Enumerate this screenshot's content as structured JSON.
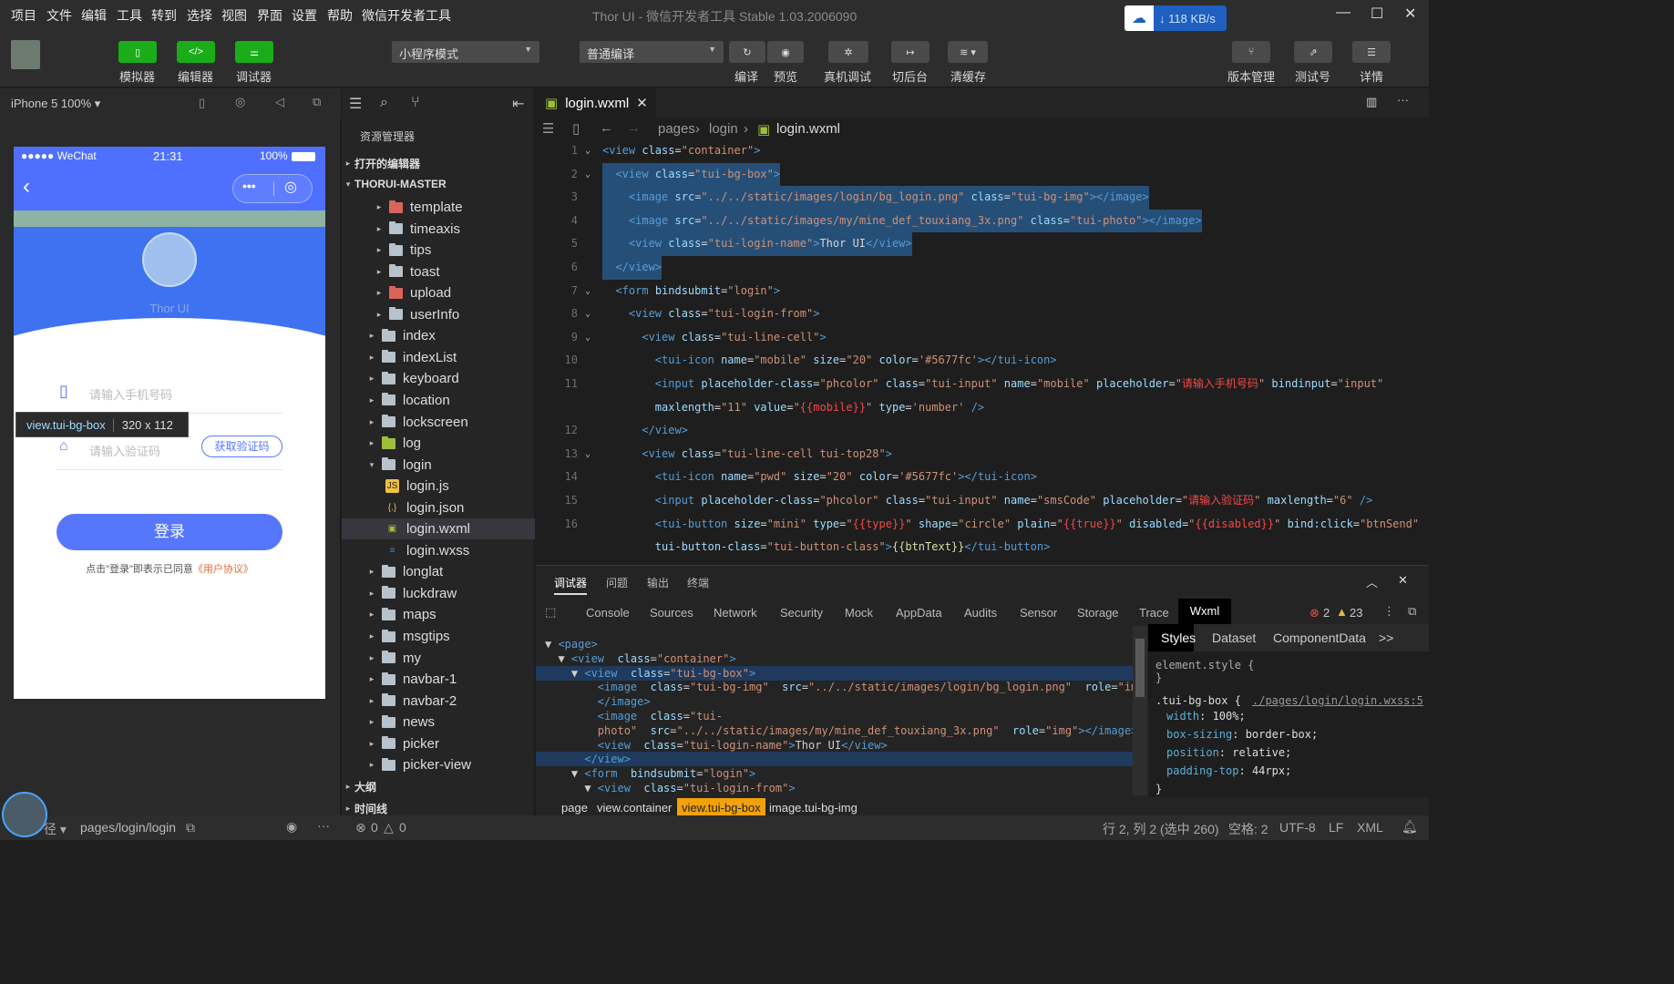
{
  "menu": [
    "项目",
    "文件",
    "编辑",
    "工具",
    "转到",
    "选择",
    "视图",
    "界面",
    "设置",
    "帮助",
    "微信开发者工具"
  ],
  "window_title": "Thor UI - 微信开发者工具 Stable 1.03.2006090",
  "network_speed": "↓ 118 KB/s",
  "toolbar": {
    "simulator": "模拟器",
    "editor": "编辑器",
    "debugger": "调试器",
    "mode_select": "小程序模式",
    "compile_select": "普通编译",
    "compile": "编译",
    "preview": "预览",
    "real_debug": "真机调试",
    "background": "切后台",
    "clear_cache": "清缓存",
    "version": "版本管理",
    "test_account": "测试号",
    "details": "详情"
  },
  "simulator": {
    "device": "iPhone 5 100%",
    "status_left": "●●●●● WeChat",
    "time": "21:31",
    "battery": "100%",
    "hero_name": "Thor UI",
    "inspect_tag": "view.tui-bg-box",
    "inspect_size": "320 x 112",
    "phone_placeholder": "请输入手机号码",
    "code_placeholder": "请输入验证码",
    "code_button": "获取验证码",
    "login_button": "登录",
    "agreement": "点击\"登录\"即表示已同意",
    "agreement_link": "《用户协议》"
  },
  "explorer": {
    "title": "资源管理器",
    "open_editors": "打开的编辑器",
    "project": "THORUI-MASTER",
    "outline": "大纲",
    "timeline": "时间线",
    "items": [
      {
        "label": "template",
        "indent": 2,
        "kind": "folder-red",
        "open": false
      },
      {
        "label": "timeaxis",
        "indent": 2,
        "kind": "folder",
        "open": false
      },
      {
        "label": "tips",
        "indent": 2,
        "kind": "folder",
        "open": false
      },
      {
        "label": "toast",
        "indent": 2,
        "kind": "folder",
        "open": false
      },
      {
        "label": "upload",
        "indent": 2,
        "kind": "folder-red",
        "open": false
      },
      {
        "label": "userInfo",
        "indent": 2,
        "kind": "folder",
        "open": false
      },
      {
        "label": "index",
        "indent": 1,
        "kind": "folder",
        "open": false
      },
      {
        "label": "indexList",
        "indent": 1,
        "kind": "folder",
        "open": false
      },
      {
        "label": "keyboard",
        "indent": 1,
        "kind": "folder",
        "open": false
      },
      {
        "label": "location",
        "indent": 1,
        "kind": "folder",
        "open": false
      },
      {
        "label": "lockscreen",
        "indent": 1,
        "kind": "folder",
        "open": false
      },
      {
        "label": "log",
        "indent": 1,
        "kind": "folder-green",
        "open": false
      },
      {
        "label": "login",
        "indent": 1,
        "kind": "folder",
        "open": true
      },
      {
        "label": "login.js",
        "indent": 2,
        "kind": "js",
        "leaf": true
      },
      {
        "label": "login.json",
        "indent": 2,
        "kind": "json",
        "leaf": true
      },
      {
        "label": "login.wxml",
        "indent": 2,
        "kind": "wxml",
        "leaf": true,
        "selected": true
      },
      {
        "label": "login.wxss",
        "indent": 2,
        "kind": "wxss",
        "leaf": true
      },
      {
        "label": "longlat",
        "indent": 1,
        "kind": "folder",
        "open": false
      },
      {
        "label": "luckdraw",
        "indent": 1,
        "kind": "folder",
        "open": false
      },
      {
        "label": "maps",
        "indent": 1,
        "kind": "folder",
        "open": false
      },
      {
        "label": "msgtips",
        "indent": 1,
        "kind": "folder",
        "open": false
      },
      {
        "label": "my",
        "indent": 1,
        "kind": "folder",
        "open": false
      },
      {
        "label": "navbar-1",
        "indent": 1,
        "kind": "folder",
        "open": false
      },
      {
        "label": "navbar-2",
        "indent": 1,
        "kind": "folder",
        "open": false
      },
      {
        "label": "news",
        "indent": 1,
        "kind": "folder",
        "open": false
      },
      {
        "label": "picker",
        "indent": 1,
        "kind": "folder",
        "open": false
      },
      {
        "label": "picker-view",
        "indent": 1,
        "kind": "folder",
        "open": false
      }
    ]
  },
  "editor": {
    "tab": "login.wxml",
    "breadcrumb": [
      "pages",
      "login",
      "login.wxml"
    ],
    "lines": [
      {
        "n": "1",
        "fold": true,
        "hl": false,
        "html": "<span class=\"t\">&lt;view</span> <span class=\"a\">class</span>=<span class=\"v\">\"container\"</span><span class=\"t\">&gt;</span>"
      },
      {
        "n": "2",
        "fold": true,
        "hl": true,
        "html": "  <span class=\"t\">&lt;view</span> <span class=\"a\">class</span>=<span class=\"v\">\"tui-bg-box\"</span><span class=\"t\">&gt;</span>"
      },
      {
        "n": "3",
        "fold": false,
        "hl": true,
        "html": "    <span class=\"t\">&lt;image</span> <span class=\"a\">src</span>=<span class=\"v\">\"../../static/images/login/bg_login.png\"</span> <span class=\"a\">class</span>=<span class=\"v\">\"tui-bg-img\"</span><span class=\"t\">&gt;&lt;/image&gt;</span>"
      },
      {
        "n": "4",
        "fold": false,
        "hl": true,
        "html": "    <span class=\"t\">&lt;image</span> <span class=\"a\">src</span>=<span class=\"v\">\"../../static/images/my/mine_def_touxiang_3x.png\"</span> <span class=\"a\">class</span>=<span class=\"v\">\"tui-photo\"</span><span class=\"t\">&gt;&lt;/image&gt;</span>"
      },
      {
        "n": "5",
        "fold": false,
        "hl": true,
        "html": "    <span class=\"t\">&lt;view</span> <span class=\"a\">class</span>=<span class=\"v\">\"tui-login-name\"</span><span class=\"t\">&gt;</span>Thor UI<span class=\"t\">&lt;/view&gt;</span>"
      },
      {
        "n": "6",
        "fold": false,
        "hl": true,
        "html": "  <span class=\"t\">&lt;/view&gt;</span>"
      },
      {
        "n": "7",
        "fold": true,
        "hl": false,
        "html": "  <span class=\"t\">&lt;form</span> <span class=\"a\">bindsubmit</span>=<span class=\"v\">\"login\"</span><span class=\"t\">&gt;</span>"
      },
      {
        "n": "8",
        "fold": true,
        "hl": false,
        "html": "    <span class=\"t\">&lt;view</span> <span class=\"a\">class</span>=<span class=\"v\">\"tui-login-from\"</span><span class=\"t\">&gt;</span>"
      },
      {
        "n": "9",
        "fold": true,
        "hl": false,
        "html": "      <span class=\"t\">&lt;view</span> <span class=\"a\">class</span>=<span class=\"v\">\"tui-line-cell\"</span><span class=\"t\">&gt;</span>"
      },
      {
        "n": "10",
        "fold": false,
        "hl": false,
        "html": "        <span class=\"t\">&lt;tui-icon</span> <span class=\"a\">name</span>=<span class=\"v\">\"mobile\"</span> <span class=\"a\">size</span>=<span class=\"v\">\"20\"</span> <span class=\"a\">color</span>=<span class=\"v\">'#5677fc'</span><span class=\"t\">&gt;&lt;/tui-icon&gt;</span>"
      },
      {
        "n": "11",
        "fold": false,
        "hl": false,
        "html": "        <span class=\"t\">&lt;input</span> <span class=\"a\">placeholder-class</span>=<span class=\"v\">\"phcolor\"</span> <span class=\"a\">class</span>=<span class=\"v\">\"tui-input\"</span> <span class=\"a\">name</span>=<span class=\"v\">\"mobile\"</span> <span class=\"a\">placeholder</span>=<span class=\"v\">\"</span><span class=\"r\">请输入手机号码</span><span class=\"v\">\"</span> <span class=\"a\">bindinput</span>=<span class=\"v\">\"input\"</span>"
      },
      {
        "n": "",
        "fold": false,
        "hl": false,
        "html": "        <span class=\"a\">maxlength</span>=<span class=\"v\">\"11\"</span> <span class=\"a\">value</span>=<span class=\"v\">\"</span><span class=\"r\">{{mobile}}</span><span class=\"v\">\"</span> <span class=\"a\">type</span>=<span class=\"v\">'number'</span> <span class=\"t\">/&gt;</span>"
      },
      {
        "n": "12",
        "fold": false,
        "hl": false,
        "html": "      <span class=\"t\">&lt;/view&gt;</span>"
      },
      {
        "n": "13",
        "fold": true,
        "hl": false,
        "html": "      <span class=\"t\">&lt;view</span> <span class=\"a\">class</span>=<span class=\"v\">\"tui-line-cell tui-top28\"</span><span class=\"t\">&gt;</span>"
      },
      {
        "n": "14",
        "fold": false,
        "hl": false,
        "html": "        <span class=\"t\">&lt;tui-icon</span> <span class=\"a\">name</span>=<span class=\"v\">\"pwd\"</span> <span class=\"a\">size</span>=<span class=\"v\">\"20\"</span> <span class=\"a\">color</span>=<span class=\"v\">'#5677fc'</span><span class=\"t\">&gt;&lt;/tui-icon&gt;</span>"
      },
      {
        "n": "15",
        "fold": false,
        "hl": false,
        "html": "        <span class=\"t\">&lt;input</span> <span class=\"a\">placeholder-class</span>=<span class=\"v\">\"phcolor\"</span> <span class=\"a\">class</span>=<span class=\"v\">\"tui-input\"</span> <span class=\"a\">name</span>=<span class=\"v\">\"smsCode\"</span> <span class=\"a\">placeholder</span>=<span class=\"v\">\"</span><span class=\"r\">请输入验证码</span><span class=\"v\">\"</span> <span class=\"a\">maxlength</span>=<span class=\"v\">\"6\"</span> <span class=\"t\">/&gt;</span>"
      },
      {
        "n": "16",
        "fold": false,
        "hl": false,
        "html": "        <span class=\"t\">&lt;tui-button</span> <span class=\"a\">size</span>=<span class=\"v\">\"mini\"</span> <span class=\"a\">type</span>=<span class=\"v\">\"</span><span class=\"r\">{{type}}</span><span class=\"v\">\"</span> <span class=\"a\">shape</span>=<span class=\"v\">\"circle\"</span> <span class=\"a\">plain</span>=<span class=\"v\">\"</span><span class=\"r\">{{true}}</span><span class=\"v\">\"</span> <span class=\"a\">disabled</span>=<span class=\"v\">\"</span><span class=\"r\">{{disabled}}</span><span class=\"v\">\"</span> <span class=\"a\">bind:click</span>=<span class=\"v\">\"btnSend\"</span>"
      },
      {
        "n": "",
        "fold": false,
        "hl": false,
        "html": "        <span class=\"a\">tui-button-class</span>=<span class=\"v\">\"tui-button-class\"</span><span class=\"t\">&gt;</span><span class=\"y\">{{btnText}}</span><span class=\"t\">&lt;/tui-button&gt;</span>"
      }
    ]
  },
  "devtools": {
    "top_tabs": [
      "调试器",
      "问题",
      "输出",
      "终端"
    ],
    "panel_tabs": [
      "Console",
      "Sources",
      "Network",
      "Security",
      "Mock",
      "AppData",
      "Audits",
      "Sensor",
      "Storage",
      "Trace",
      "Wxml"
    ],
    "errors": "2",
    "warnings": "23",
    "dom_lines": [
      {
        "html": "▼ <span class=\"t\">&lt;page&gt;</span>",
        "sel": false
      },
      {
        "html": "  ▼ <span class=\"t\">&lt;view</span>  <span class=\"a\">class</span>=<span class=\"v\">\"container\"</span><span class=\"t\">&gt;</span>",
        "sel": false
      },
      {
        "html": "    ▼ <span class=\"t\">&lt;view</span>  <span class=\"a\">class</span>=<span class=\"v\">\"tui-bg-box\"</span><span class=\"t\">&gt;</span>",
        "sel": true
      },
      {
        "html": "        <span class=\"t\">&lt;image</span>  <span class=\"a\">class</span>=<span class=\"v\">\"tui-bg-img\"</span>  <span class=\"a\">src</span>=<span class=\"v\">\"../../static/images/login/bg_login.png\"</span>  <span class=\"a\">role</span>=<span class=\"v\">\"img\"</span><span class=\"t\">&gt;</span>",
        "sel": false
      },
      {
        "html": "        <span class=\"t\">&lt;/image&gt;</span>",
        "sel": false
      },
      {
        "html": "        <span class=\"t\">&lt;image</span>  <span class=\"a\">class</span>=<span class=\"v\">\"tui-</span>",
        "sel": false
      },
      {
        "html": "        <span class=\"v\">photo\"</span>  <span class=\"a\">src</span>=<span class=\"v\">\"../../static/images/my/mine_def_touxiang_3x.png\"</span>  <span class=\"a\">role</span>=<span class=\"v\">\"img\"</span><span class=\"t\">&gt;&lt;/image&gt;</span>",
        "sel": false
      },
      {
        "html": "        <span class=\"t\">&lt;view</span>  <span class=\"a\">class</span>=<span class=\"v\">\"tui-login-name\"</span><span class=\"t\">&gt;</span>Thor UI<span class=\"t\">&lt;/view&gt;</span>",
        "sel": false
      },
      {
        "html": "      <span class=\"t\">&lt;/view&gt;</span>",
        "sel": true
      },
      {
        "html": "    ▼ <span class=\"t\">&lt;form</span>  <span class=\"a\">bindsubmit</span>=<span class=\"v\">\"login\"</span><span class=\"t\">&gt;</span>",
        "sel": false
      },
      {
        "html": "      ▼ <span class=\"t\">&lt;view</span>  <span class=\"a\">class</span>=<span class=\"v\">\"tui-login-from\"</span><span class=\"t\">&gt;</span>",
        "sel": false
      }
    ],
    "style_tabs": [
      "Styles",
      "Dataset",
      "ComponentData",
      ">>"
    ],
    "element_style": "element.style {",
    "rule_selector": ".tui-bg-box {",
    "rule_source": "./pages/login/login.wxss:5",
    "props": [
      {
        "name": "width",
        "value": "100%;"
      },
      {
        "name": "box-sizing",
        "value": "border-box;"
      },
      {
        "name": "position",
        "value": "relative;"
      },
      {
        "name": "padding-top",
        "value": "44rpx;"
      }
    ],
    "dom_breadcrumb": [
      "page",
      "view.container",
      "view.tui-bg-box",
      "image.tui-bg-img"
    ]
  },
  "statusbar": {
    "page_path": "pages/login/login",
    "issues_errors": "0",
    "issues_warnings": "0",
    "cursor": "行 2, 列 2 (选中 260)",
    "spaces": "空格: 2",
    "encoding": "UTF-8",
    "eol": "LF",
    "language": "XML"
  },
  "colors": {
    "accent": "#5677fc",
    "green": "#1aad19",
    "selection": "#264f78"
  }
}
